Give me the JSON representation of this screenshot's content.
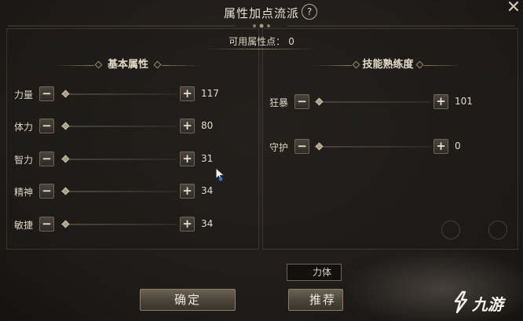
{
  "window": {
    "title": "属性加点流派",
    "help_icon": "?",
    "close_icon": "✕"
  },
  "available_points": {
    "label": "可用属性点：",
    "value": "0"
  },
  "basic_attributes": {
    "heading": "基本属性",
    "rows": [
      {
        "name": "力量",
        "value": "117"
      },
      {
        "name": "体力",
        "value": "80"
      },
      {
        "name": "智力",
        "value": "31"
      },
      {
        "name": "精神",
        "value": "34"
      },
      {
        "name": "敏捷",
        "value": "34"
      }
    ]
  },
  "skill_proficiency": {
    "heading": "技能熟练度",
    "rows": [
      {
        "name": "狂暴",
        "value": "101"
      },
      {
        "name": "守护",
        "value": "0"
      }
    ]
  },
  "controls": {
    "minus": "−",
    "plus": "+"
  },
  "bottom": {
    "field_text": "力体",
    "confirm_label": "确定",
    "recommend_label": "推荐"
  },
  "watermark": {
    "text": "九游"
  },
  "colors": {
    "background": "#1f1c1a",
    "panel_border": "#3a342d",
    "text": "#d9d2c4",
    "button_gradient_top": "#6b6254"
  }
}
